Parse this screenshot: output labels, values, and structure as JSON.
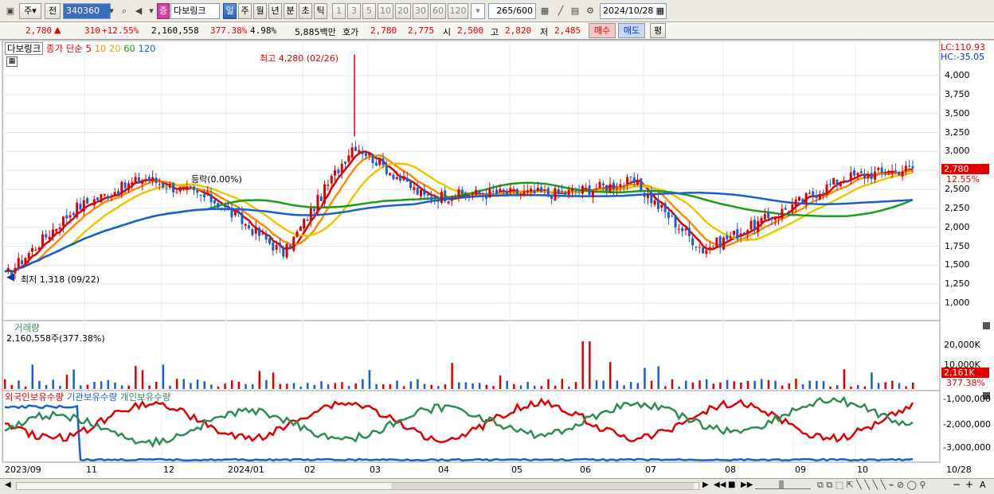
{
  "toolbar": {
    "mode_label": "주",
    "prev_label": "전",
    "stock_code": "340360",
    "stock_name": "다보링크",
    "name_badge": "증",
    "periods": [
      "일",
      "주",
      "월",
      "년",
      "분",
      "초",
      "틱"
    ],
    "active_period": "일",
    "intervals": [
      "1",
      "3",
      "5",
      "10",
      "20",
      "30",
      "60",
      "120"
    ],
    "count": "265",
    "count_max": "/600",
    "date": "2024/10/28"
  },
  "quote": {
    "price": "2,780",
    "change_arrow": "▲",
    "change": "310",
    "change_pct": "+12.55%",
    "volume": "2,160,558",
    "volume_ratio": "377.38%",
    "turnover": "4.98%",
    "amount": "5,885백만",
    "bid_label": "호가",
    "bid1": "2,780",
    "bid2": "2,775",
    "open_label": "시",
    "open": "2,500",
    "high_label": "고",
    "high": "2,820",
    "low_label": "저",
    "low": "2,485",
    "buy_label": "매수",
    "sell_label": "매도",
    "eval_label": "평"
  },
  "price_panel": {
    "name": "다보링크",
    "ma_label": "종가 단순",
    "ma_periods": [
      "5",
      "10",
      "20",
      "60",
      "120"
    ],
    "ma_colors": [
      "#e00000",
      "#ff8c00",
      "#e8c800",
      "#1a9e1a",
      "#1a5fd0"
    ],
    "lc_label": "LC:110.93",
    "hc_label": "HC:-35.05",
    "high_annotation": "최고 4,280 (02/26)",
    "low_annotation": "최저 1,318 (09/22)",
    "pct_annotation": "등락(0.00%)",
    "current_price_tag": "2,780",
    "current_pct_tag": "12.55%",
    "y_ticks": [
      "4,000",
      "3,750",
      "3,500",
      "3,250",
      "3,000",
      "2,750",
      "2,500",
      "2,250",
      "2,000",
      "1,750",
      "1,500",
      "1,250",
      "1,000"
    ]
  },
  "volume_panel": {
    "title": "거래량",
    "value_label": "2,160,558주(377.38%)",
    "y_ticks": [
      "20,000K",
      "10,000K"
    ],
    "current_tag": "2,161K",
    "current_pct": "377.38%"
  },
  "holdings_panel": {
    "series": [
      "외국인보유수량",
      "기관보유수량",
      "개인보유수량"
    ],
    "series_colors": [
      "#e00000",
      "#1a5fd0",
      "#2e8b57"
    ],
    "y_ticks": [
      "-1,000,000",
      "-2,000,000",
      "-3,000,000"
    ]
  },
  "x_axis": {
    "labels": [
      "2023/09",
      "11",
      "12",
      "2024/01",
      "02",
      "03",
      "04",
      "05",
      "06",
      "07",
      "08",
      "09",
      "10"
    ],
    "end_label": "10/28"
  },
  "chart_data": {
    "type": "line",
    "title": "다보링크",
    "x": [
      "2023/09",
      "11",
      "12",
      "2024/01",
      "02",
      "03",
      "04",
      "05",
      "06",
      "07",
      "08",
      "09",
      "10",
      "10/28"
    ],
    "series": [
      {
        "name": "종가",
        "values": [
          1350,
          2250,
          2650,
          2350,
          1650,
          3100,
          2400,
          2450,
          2450,
          2600,
          1700,
          2150,
          2650,
          2780
        ]
      },
      {
        "name": "120",
        "values": [
          1100,
          1250,
          1400,
          1600,
          1900,
          2150,
          2300,
          2400,
          2450,
          2450,
          2400,
          2350,
          2380,
          2400
        ]
      }
    ],
    "ylim": [
      900,
      4300
    ],
    "grid": true
  }
}
